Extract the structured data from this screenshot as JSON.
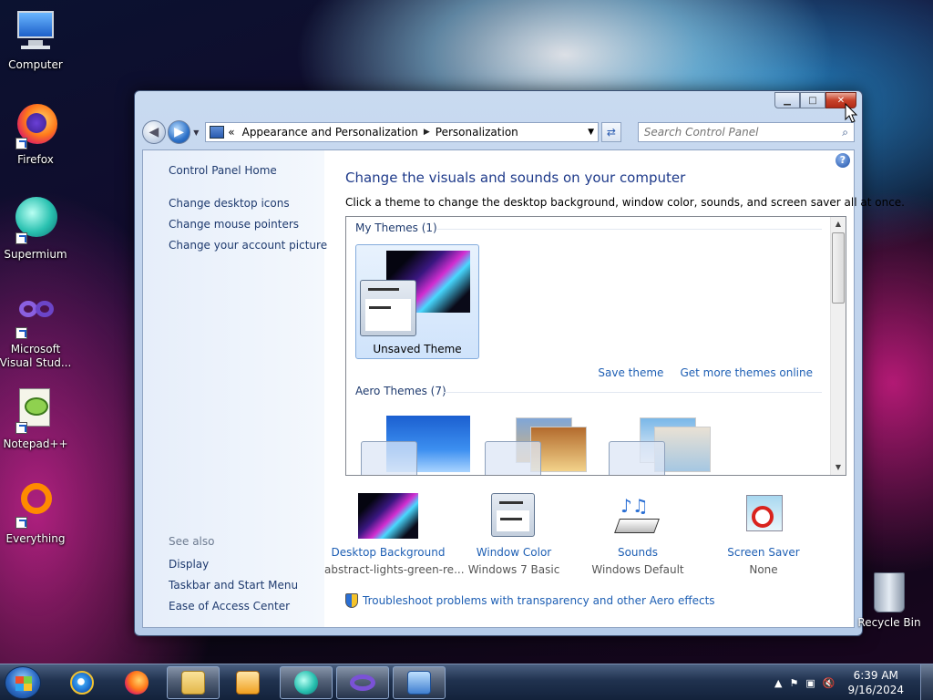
{
  "desktop": {
    "icons": [
      {
        "label": "Computer"
      },
      {
        "label": "Firefox"
      },
      {
        "label": "Supermium"
      },
      {
        "label": "Microsoft Visual Stud..."
      },
      {
        "label": "Notepad++"
      },
      {
        "label": "Everything"
      }
    ],
    "recycle_bin": "Recycle Bin"
  },
  "window": {
    "breadcrumb": {
      "prefix": "«",
      "items": [
        "Appearance and Personalization",
        "Personalization"
      ]
    },
    "search_placeholder": "Search Control Panel",
    "sidebar": {
      "home": "Control Panel Home",
      "links": [
        "Change desktop icons",
        "Change mouse pointers",
        "Change your account picture"
      ],
      "see_also_title": "See also",
      "see_also": [
        "Display",
        "Taskbar and Start Menu",
        "Ease of Access Center"
      ]
    },
    "main": {
      "title": "Change the visuals and sounds on your computer",
      "subtitle": "Click a theme to change the desktop background, window color, sounds, and screen saver all at once.",
      "my_themes_header": "My Themes (1)",
      "selected_theme": "Unsaved Theme",
      "save_theme": "Save theme",
      "get_more": "Get more themes online",
      "aero_header": "Aero Themes (7)",
      "options": [
        {
          "title": "Desktop Background",
          "value": "abstract-lights-green-re..."
        },
        {
          "title": "Window Color",
          "value": "Windows 7 Basic"
        },
        {
          "title": "Sounds",
          "value": "Windows Default"
        },
        {
          "title": "Screen Saver",
          "value": "None"
        }
      ],
      "troubleshoot": "Troubleshoot problems with transparency and other Aero effects"
    }
  },
  "taskbar": {
    "clock_time": "6:39 AM",
    "clock_date": "9/16/2024"
  },
  "colors": {
    "link": "#1e5fb4",
    "title": "#1e3a8a",
    "sidebar_link": "#1e3a6e"
  }
}
